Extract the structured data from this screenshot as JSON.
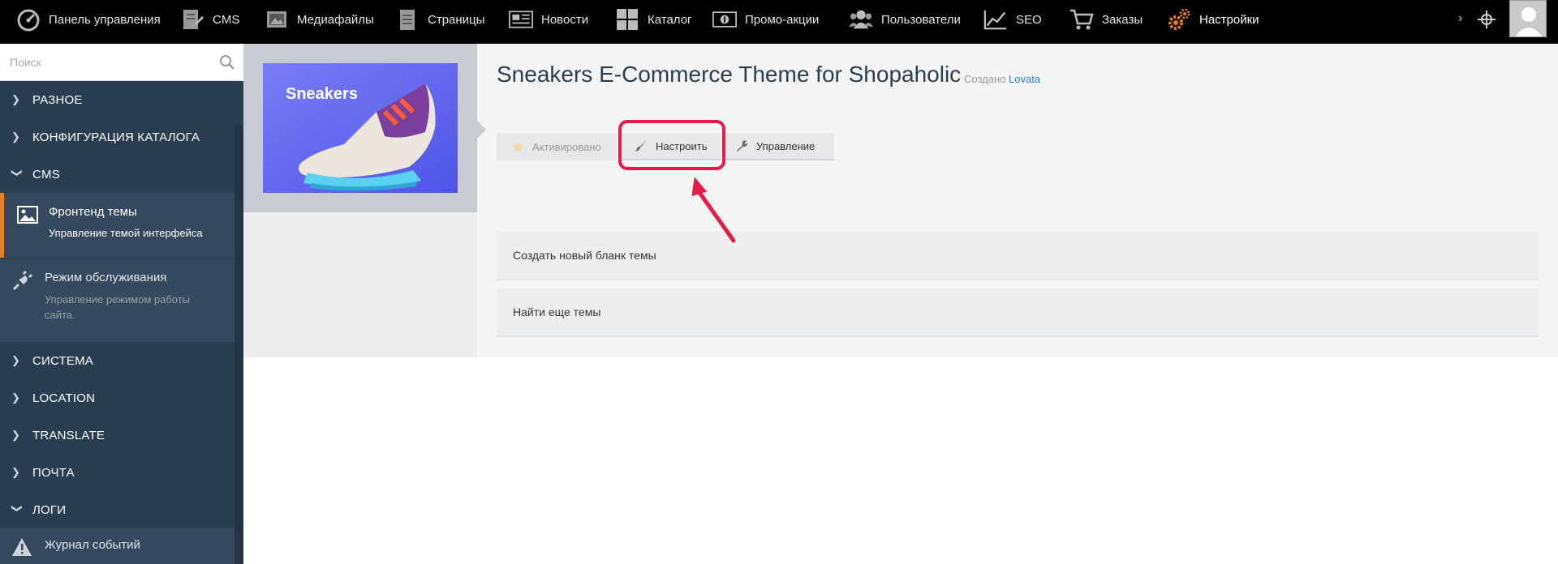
{
  "topnav": {
    "items": [
      {
        "label": "Панель управления",
        "icon": "dashboard-icon"
      },
      {
        "label": "CMS",
        "icon": "cms-icon"
      },
      {
        "label": "Медиафайлы",
        "icon": "media-icon"
      },
      {
        "label": "Страницы",
        "icon": "pages-icon"
      },
      {
        "label": "Новости",
        "icon": "news-icon"
      },
      {
        "label": "Каталог",
        "icon": "catalog-icon"
      },
      {
        "label": "Промо-акции",
        "icon": "promo-icon"
      },
      {
        "label": "Пользователи",
        "icon": "users-icon"
      },
      {
        "label": "SEO",
        "icon": "seo-icon"
      },
      {
        "label": "Заказы",
        "icon": "cart-icon"
      },
      {
        "label": "Настройки",
        "icon": "settings-gears-icon",
        "active": true
      }
    ],
    "more_glyph": "›",
    "accent_color": "#e67e22"
  },
  "sidebar": {
    "search_placeholder": "Поиск",
    "sections": [
      {
        "label": "РАЗНОЕ",
        "expanded": false
      },
      {
        "label": "КОНФИГУРАЦИЯ КАТАЛОГА",
        "expanded": false
      },
      {
        "label": "CMS",
        "expanded": true
      },
      {
        "label": "СИСТЕМА",
        "expanded": false
      },
      {
        "label": "LOCATION",
        "expanded": false
      },
      {
        "label": "TRANSLATE",
        "expanded": false
      },
      {
        "label": "ПОЧТА",
        "expanded": false
      },
      {
        "label": "ЛОГИ",
        "expanded": true
      }
    ],
    "cms_items": [
      {
        "title": "Фронтенд темы",
        "desc": "Управление темой интерфейса",
        "icon": "picture-icon",
        "active": true
      },
      {
        "title": "Режим обслуживания",
        "desc": "Управление режимом работы сайта.",
        "icon": "plug-icon",
        "active": false
      }
    ],
    "log_items": [
      {
        "title": "Журнал событий",
        "icon": "warning-icon"
      }
    ]
  },
  "theme": {
    "thumbnail_text": "Sneakers",
    "title": "Sneakers E-Commerce Theme for Shopaholic",
    "by_label": "Создано",
    "author": "Lovata",
    "buttons": {
      "activated": "Активировано",
      "customize": "Настроить",
      "manage": "Управление"
    }
  },
  "actions": [
    {
      "label": "Создать новый бланк темы"
    },
    {
      "label": "Найти еще темы"
    }
  ],
  "annotation_color": "#e11d48"
}
